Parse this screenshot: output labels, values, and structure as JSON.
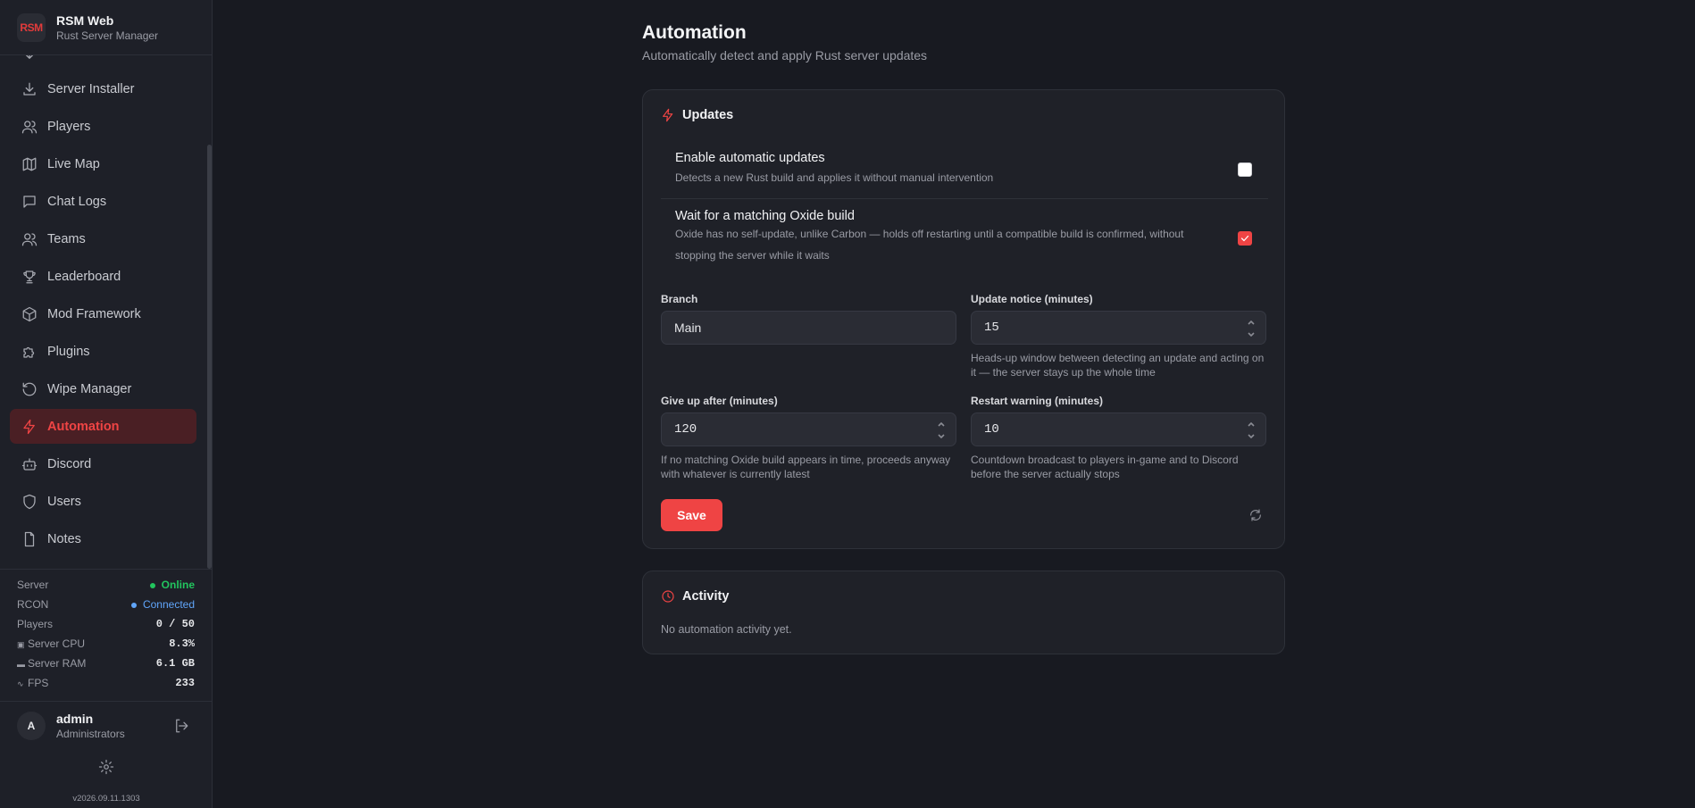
{
  "app": {
    "logo": "RSM",
    "title": "RSM Web",
    "subtitle": "Rust Server Manager"
  },
  "sidebar": {
    "items": [
      {
        "label": "Server Installer",
        "icon": "download-icon"
      },
      {
        "label": "Players",
        "icon": "users-icon"
      },
      {
        "label": "Live Map",
        "icon": "map-icon"
      },
      {
        "label": "Chat Logs",
        "icon": "chat-icon"
      },
      {
        "label": "Teams",
        "icon": "users-icon"
      },
      {
        "label": "Leaderboard",
        "icon": "trophy-icon"
      },
      {
        "label": "Mod Framework",
        "icon": "box-icon"
      },
      {
        "label": "Plugins",
        "icon": "puzzle-icon"
      },
      {
        "label": "Wipe Manager",
        "icon": "rotate-icon"
      },
      {
        "label": "Automation",
        "icon": "bolt-icon",
        "active": true
      },
      {
        "label": "Discord",
        "icon": "bot-icon"
      },
      {
        "label": "Users",
        "icon": "shield-icon"
      },
      {
        "label": "Notes",
        "icon": "file-icon"
      }
    ]
  },
  "status": {
    "server_label": "Server",
    "server_value": "Online",
    "rcon_label": "RCON",
    "rcon_value": "Connected",
    "players_label": "Players",
    "players_value": "0 / 50",
    "cpu_label": "Server CPU",
    "cpu_value": "8.3%",
    "ram_label": "Server RAM",
    "ram_value": "6.1 GB",
    "fps_label": "FPS",
    "fps_value": "233"
  },
  "user": {
    "initial": "A",
    "name": "admin",
    "role": "Administrators"
  },
  "version": "v2026.09.11.1303",
  "page": {
    "title": "Automation",
    "subtitle": "Automatically detect and apply Rust server updates"
  },
  "updates": {
    "heading": "Updates",
    "auto_title": "Enable automatic updates",
    "auto_desc": "Detects a new Rust build and applies it without manual intervention",
    "auto_checked": false,
    "oxide_title": "Wait for a matching Oxide build",
    "oxide_desc": "Oxide has no self-update, unlike Carbon — holds off restarting until a compatible build is confirmed, without stopping the server while it waits",
    "oxide_checked": true,
    "branch_label": "Branch",
    "branch_value": "Main",
    "notice_label": "Update notice (minutes)",
    "notice_value": "15",
    "notice_hint": "Heads-up window between detecting an update and acting on it — the server stays up the whole time",
    "giveup_label": "Give up after (minutes)",
    "giveup_value": "120",
    "giveup_hint": "If no matching Oxide build appears in time, proceeds anyway with whatever is currently latest",
    "restart_label": "Restart warning (minutes)",
    "restart_value": "10",
    "restart_hint": "Countdown broadcast to players in-game and to Discord before the server actually stops",
    "save_label": "Save"
  },
  "activity": {
    "heading": "Activity",
    "empty": "No automation activity yet."
  },
  "colors": {
    "accent": "#ef4444",
    "online": "#22c55e",
    "connected": "#60a5fa"
  }
}
